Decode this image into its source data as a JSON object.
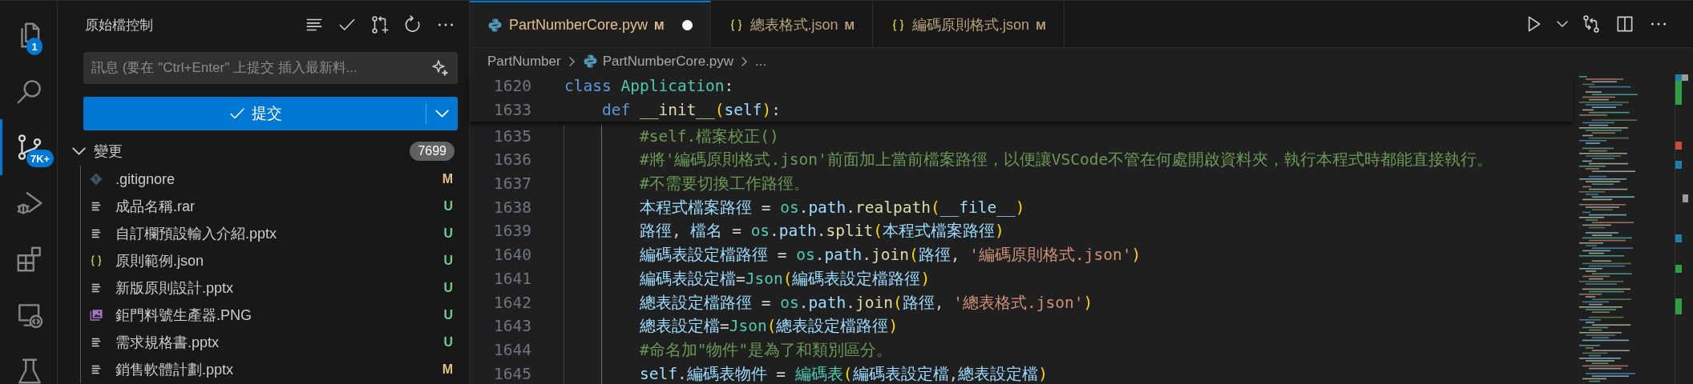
{
  "activity_bar": {
    "items": [
      {
        "kind": "files",
        "selected": false,
        "badge": "1"
      },
      {
        "kind": "search",
        "selected": false
      },
      {
        "kind": "source-control",
        "selected": true,
        "badge": "7K+"
      },
      {
        "kind": "run-debug",
        "selected": false
      },
      {
        "kind": "extensions",
        "selected": false
      },
      {
        "kind": "remote",
        "selected": false
      },
      {
        "kind": "flask",
        "selected": false
      }
    ]
  },
  "sidebar": {
    "title": "原始檔控制",
    "actions": [
      {
        "kind": "list"
      },
      {
        "kind": "check"
      },
      {
        "kind": "pull-request"
      },
      {
        "kind": "refresh"
      },
      {
        "kind": "more"
      }
    ],
    "message": {
      "placeholder": "訊息 (要在 \"Ctrl+Enter\" 上提交 插入最新料..."
    },
    "commit_button": {
      "label": "提交"
    },
    "changes": {
      "label": "變更",
      "count": "7699",
      "expanded": true,
      "files": [
        {
          "kind": "git",
          "name": ".gitignore",
          "status": "M",
          "color": "#e2c08d"
        },
        {
          "kind": "text",
          "name": "成品名稱.rar",
          "status": "U",
          "color": "#73c991"
        },
        {
          "kind": "text",
          "name": "自訂欄預設輸入介紹.pptx",
          "status": "U",
          "color": "#73c991"
        },
        {
          "kind": "json",
          "name": "原則範例.json",
          "status": "U",
          "color": "#73c991"
        },
        {
          "kind": "text",
          "name": "新版原則設計.pptx",
          "status": "U",
          "color": "#73c991"
        },
        {
          "kind": "image",
          "name": "鉅門料號生產器.PNG",
          "status": "U",
          "color": "#73c991"
        },
        {
          "kind": "text",
          "name": "需求規格書.pptx",
          "status": "U",
          "color": "#73c991"
        },
        {
          "kind": "text",
          "name": "銷售軟體計劃.pptx",
          "status": "M",
          "color": "#e2c08d"
        }
      ]
    }
  },
  "editor": {
    "tabs": [
      {
        "kind": "python",
        "label": "PartNumberCore.pyw",
        "status": "M",
        "dirty": true,
        "selected": true
      },
      {
        "kind": "json",
        "label": "總表格式.json",
        "status": "M",
        "dirty": false,
        "selected": false
      },
      {
        "kind": "json",
        "label": "編碼原則格式.json",
        "status": "M",
        "dirty": false,
        "selected": false
      }
    ],
    "actions": [
      {
        "kind": "run"
      },
      {
        "kind": "chevron-down"
      },
      {
        "kind": "compare"
      },
      {
        "kind": "split"
      },
      {
        "kind": "more"
      }
    ],
    "breadcrumb": [
      {
        "label": "PartNumber"
      },
      {
        "label": "PartNumberCore.pyw",
        "kind": "python"
      },
      {
        "label": "..."
      }
    ],
    "sticky_lines": [
      {
        "number": "1620",
        "tokens": [
          {
            "kind": "keyword",
            "text": "class "
          },
          {
            "kind": "type",
            "text": "Application"
          },
          {
            "kind": "plain",
            "text": ":"
          }
        ],
        "children": [
          {
            "number": "1633",
            "tokens": [
              {
                "kind": "keyword",
                "text": "def "
              },
              {
                "kind": "function",
                "text": "__init__"
              },
              {
                "kind": "bracket",
                "text": "("
              },
              {
                "kind": "variable",
                "text": "self"
              },
              {
                "kind": "bracket",
                "text": ")"
              },
              {
                "kind": "plain",
                "text": ":"
              }
            ]
          }
        ]
      }
    ],
    "lines": [
      {
        "number": "1635",
        "tokens": [
          {
            "kind": "comment",
            "text": "#self.檔案校正()"
          }
        ]
      },
      {
        "number": "1636",
        "tokens": [
          {
            "kind": "comment",
            "text": "#將'編碼原則格式.json'前面加上當前檔案路徑，以便讓VSCode不管在何處開啟資料夾，執行本程式時都能直接執行。"
          }
        ]
      },
      {
        "number": "1637",
        "tokens": [
          {
            "kind": "comment",
            "text": "#不需要切換工作路徑。"
          }
        ]
      },
      {
        "number": "1638",
        "tokens": [
          {
            "kind": "variable",
            "text": "本程式檔案路徑"
          },
          {
            "kind": "plain",
            "text": " = "
          },
          {
            "kind": "type",
            "text": "os"
          },
          {
            "kind": "plain",
            "text": "."
          },
          {
            "kind": "variable",
            "text": "path"
          },
          {
            "kind": "plain",
            "text": "."
          },
          {
            "kind": "function",
            "text": "realpath"
          },
          {
            "kind": "bracket",
            "text": "("
          },
          {
            "kind": "variable",
            "text": "__file__"
          },
          {
            "kind": "bracket",
            "text": ")"
          }
        ]
      },
      {
        "number": "1639",
        "tokens": [
          {
            "kind": "variable",
            "text": "路徑"
          },
          {
            "kind": "plain",
            "text": ", "
          },
          {
            "kind": "variable",
            "text": "檔名"
          },
          {
            "kind": "plain",
            "text": " = "
          },
          {
            "kind": "type",
            "text": "os"
          },
          {
            "kind": "plain",
            "text": "."
          },
          {
            "kind": "variable",
            "text": "path"
          },
          {
            "kind": "plain",
            "text": "."
          },
          {
            "kind": "function",
            "text": "split"
          },
          {
            "kind": "bracket",
            "text": "("
          },
          {
            "kind": "variable",
            "text": "本程式檔案路徑"
          },
          {
            "kind": "bracket",
            "text": ")"
          }
        ]
      },
      {
        "number": "1640",
        "tokens": [
          {
            "kind": "variable",
            "text": "編碼表設定檔路徑"
          },
          {
            "kind": "plain",
            "text": " = "
          },
          {
            "kind": "type",
            "text": "os"
          },
          {
            "kind": "plain",
            "text": "."
          },
          {
            "kind": "variable",
            "text": "path"
          },
          {
            "kind": "plain",
            "text": "."
          },
          {
            "kind": "function",
            "text": "join"
          },
          {
            "kind": "bracket",
            "text": "("
          },
          {
            "kind": "variable",
            "text": "路徑"
          },
          {
            "kind": "plain",
            "text": ", "
          },
          {
            "kind": "string",
            "text": "'編碼原則格式.json'"
          },
          {
            "kind": "bracket",
            "text": ")"
          }
        ]
      },
      {
        "number": "1641",
        "tokens": [
          {
            "kind": "variable",
            "text": "編碼表設定檔"
          },
          {
            "kind": "plain",
            "text": "="
          },
          {
            "kind": "type",
            "text": "Json"
          },
          {
            "kind": "bracket",
            "text": "("
          },
          {
            "kind": "variable",
            "text": "編碼表設定檔路徑"
          },
          {
            "kind": "bracket",
            "text": ")"
          }
        ]
      },
      {
        "number": "1642",
        "tokens": [
          {
            "kind": "variable",
            "text": "總表設定檔路徑"
          },
          {
            "kind": "plain",
            "text": " = "
          },
          {
            "kind": "type",
            "text": "os"
          },
          {
            "kind": "plain",
            "text": "."
          },
          {
            "kind": "variable",
            "text": "path"
          },
          {
            "kind": "plain",
            "text": "."
          },
          {
            "kind": "function",
            "text": "join"
          },
          {
            "kind": "bracket",
            "text": "("
          },
          {
            "kind": "variable",
            "text": "路徑"
          },
          {
            "kind": "plain",
            "text": ", "
          },
          {
            "kind": "string",
            "text": "'總表格式.json'"
          },
          {
            "kind": "bracket",
            "text": ")"
          }
        ]
      },
      {
        "number": "1643",
        "tokens": [
          {
            "kind": "variable",
            "text": "總表設定檔"
          },
          {
            "kind": "plain",
            "text": "="
          },
          {
            "kind": "type",
            "text": "Json"
          },
          {
            "kind": "bracket",
            "text": "("
          },
          {
            "kind": "variable",
            "text": "總表設定檔路徑"
          },
          {
            "kind": "bracket",
            "text": ")"
          }
        ]
      },
      {
        "number": "1644",
        "tokens": [
          {
            "kind": "comment",
            "text": "#命名加\"物件\"是為了和類別區分。"
          }
        ]
      },
      {
        "number": "1645",
        "tokens": [
          {
            "kind": "variable",
            "text": "self"
          },
          {
            "kind": "plain",
            "text": "."
          },
          {
            "kind": "variable",
            "text": "編碼表物件"
          },
          {
            "kind": "plain",
            "text": " = "
          },
          {
            "kind": "type",
            "text": "編碼表"
          },
          {
            "kind": "bracket",
            "text": "("
          },
          {
            "kind": "variable",
            "text": "編碼表設定檔"
          },
          {
            "kind": "plain",
            "text": ","
          },
          {
            "kind": "variable",
            "text": "總表設定檔"
          },
          {
            "kind": "bracket",
            "text": ")"
          }
        ]
      }
    ]
  }
}
